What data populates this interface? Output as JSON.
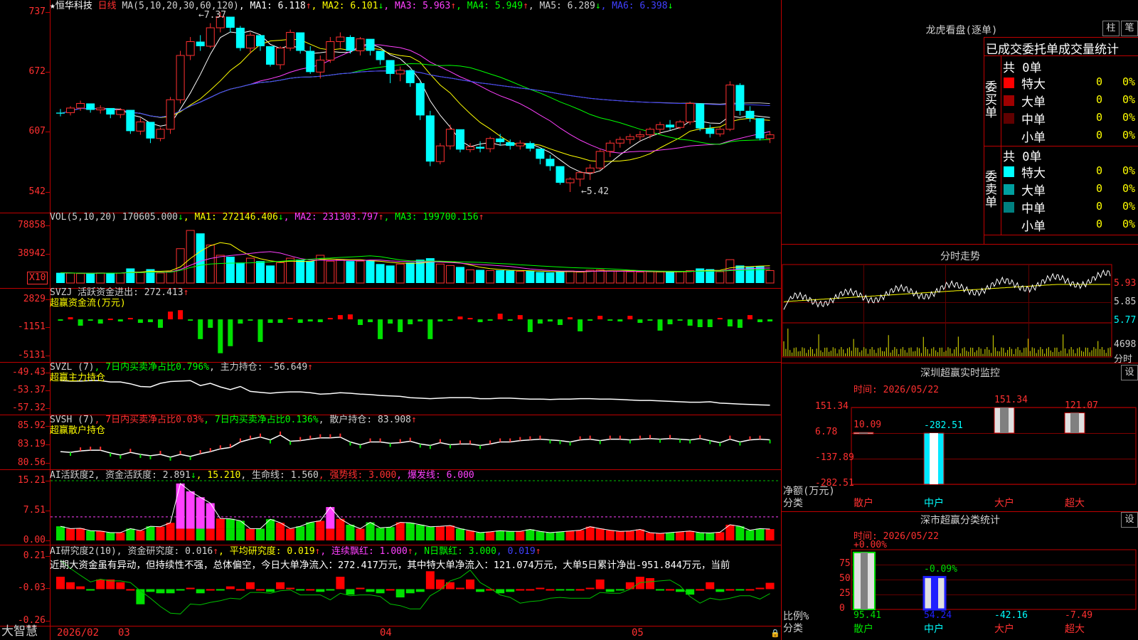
{
  "app": {
    "brand": "大智慧",
    "lock_icon": "lock-icon"
  },
  "main": {
    "title_star": "★",
    "stock_name": "恒华科技",
    "period": "日线",
    "ma_header": [
      {
        "text": "MA(5,10,20,30,60,120)",
        "color": "#d0d0d0"
      },
      {
        "text": "MA1: 6.118",
        "color": "#ffffff",
        "arrow": "↑"
      },
      {
        "text": "MA2: 6.101",
        "color": "#ffff00",
        "arrow": "↓"
      },
      {
        "text": "MA3: 5.963",
        "color": "#ff40ff",
        "arrow": "↑"
      },
      {
        "text": "MA4: 5.949",
        "color": "#00ff00",
        "arrow": "↑"
      },
      {
        "text": "MA5: 6.289",
        "color": "#d0d0d0",
        "arrow": "↓"
      },
      {
        "text": "MA6: 6.398",
        "color": "#4040ff",
        "arrow": "↓"
      }
    ],
    "high_note": "←7.37",
    "low_note": "←5.42",
    "yticks": [
      "737",
      "672",
      "607",
      "542"
    ]
  },
  "vol": {
    "header": [
      {
        "text": "VOL(5,10,20)  170605.000",
        "color": "#d0d0d0",
        "arrow": "↓"
      },
      {
        "text": "MA1: 272146.406",
        "color": "#ffff00",
        "arrow": "↓"
      },
      {
        "text": "MA2: 231303.797",
        "color": "#ff40ff",
        "arrow": "↑"
      },
      {
        "text": "MA3: 199700.156",
        "color": "#00ff00",
        "arrow": "↑"
      }
    ],
    "yticks": [
      "78858",
      "38942"
    ],
    "unit": "X10"
  },
  "svzj": {
    "header": [
      {
        "text": "SVZJ  活跃资金进出: 272.413",
        "color": "#d0d0d0",
        "arrow": "↑"
      }
    ],
    "subtitle": "超赢资金流(万元)",
    "yticks": [
      "2829",
      "-1151",
      "-5131"
    ]
  },
  "svzl": {
    "header": [
      {
        "text": "SVZL (7)",
        "color": "#d0d0d0"
      },
      {
        "text": "7日内买卖净占比0.796%",
        "color": "#00ff00"
      },
      {
        "text": "主力持仓: -56.649",
        "color": "#d0d0d0",
        "arrow": "↑"
      }
    ],
    "subtitle": "超赢主力持仓",
    "yticks": [
      "-49.43",
      "-53.37",
      "-57.32"
    ]
  },
  "svsh": {
    "header": [
      {
        "text": "SVSH (7)",
        "color": "#d0d0d0"
      },
      {
        "text": "7日内买卖净占比0.03%",
        "color": "#ff3030"
      },
      {
        "text": "7日内买卖净占比0.136%",
        "color": "#00ff00"
      },
      {
        "text": "散户持仓: 83.908",
        "color": "#d0d0d0",
        "arrow": "↑"
      }
    ],
    "subtitle": "超赢散户持仓",
    "yticks": [
      "85.92",
      "83.19",
      "80.56"
    ]
  },
  "ai1": {
    "header": [
      {
        "text": "AI活跃度2",
        "color": "#d0d0d0"
      },
      {
        "text": "资金活跃度: 2.891",
        "color": "#d0d0d0",
        "arrow": "↓"
      },
      {
        "text": "15.210",
        "color": "#ffff00"
      },
      {
        "text": "生命线: 1.560",
        "color": "#d0d0d0"
      },
      {
        "text": "强势线: 3.000",
        "color": "#ff3030"
      },
      {
        "text": "爆发线: 6.000",
        "color": "#ff40ff"
      }
    ],
    "yticks": [
      "15.21",
      "7.51",
      "0.00"
    ]
  },
  "ai2": {
    "header": [
      {
        "text": "AI研究度2(10)",
        "color": "#d0d0d0"
      },
      {
        "text": "资金研究度: 0.016",
        "color": "#d0d0d0",
        "arrow": "↑"
      },
      {
        "text": "平均研究度: 0.019",
        "color": "#ffff00",
        "arrow": "↑"
      },
      {
        "text": "连续飘红: 1.000",
        "color": "#ff40ff",
        "arrow": "↑"
      },
      {
        "text": "N日飘红: 3.000",
        "color": "#00ff00"
      },
      {
        "text": "0.019",
        "color": "#4040ff",
        "arrow": "↑"
      }
    ],
    "comment": "近期大资金虽有异动，但持续性不强，总体偏空，今日大单净流入：272.417万元，其中特大单净流入：121.074万元，大单5日累计净出-951.844万元，当前",
    "yticks": [
      "0.21",
      "-0.03",
      "-0.26"
    ]
  },
  "xaxis": {
    "labels": [
      "2026/02",
      "03",
      "04",
      "05"
    ]
  },
  "dragon": {
    "title": "龙虎看盘(逐单)",
    "btn1": "柱",
    "btn2": "笔",
    "subtitle": "已成交委托单成交量统计",
    "buy_side": "委买单",
    "sell_side": "委卖单",
    "buy_total": "共 0单",
    "sell_total": "共 0单",
    "buy_rows": [
      {
        "label": "特大",
        "count": "0",
        "pct": "0%",
        "color": "#ff0000"
      },
      {
        "label": "大单",
        "count": "0",
        "pct": "0%",
        "color": "#a00000"
      },
      {
        "label": "中单",
        "count": "0",
        "pct": "0%",
        "color": "#600000"
      },
      {
        "label": "小单",
        "count": "0",
        "pct": "0%",
        "color": ""
      }
    ],
    "sell_rows": [
      {
        "label": "特大",
        "count": "0",
        "pct": "0%",
        "color": "#00ffff"
      },
      {
        "label": "大单",
        "count": "0",
        "pct": "0%",
        "color": "#00a0a0"
      },
      {
        "label": "中单",
        "count": "0",
        "pct": "0%",
        "color": "#008080"
      },
      {
        "label": "小单",
        "count": "0",
        "pct": "0%",
        "color": ""
      }
    ]
  },
  "intraday": {
    "title": "分时走势",
    "yticks": [
      "5.93",
      "5.85",
      "5.77"
    ],
    "vol_tick": "4698",
    "vol_label": "分时"
  },
  "monitor": {
    "title": "深圳超赢实时监控",
    "setting": "设",
    "time": "时间: 2026/05/22",
    "yticks": [
      "151.34",
      "6.78",
      "-137.89",
      "-282.51"
    ],
    "ylabel": "净额(万元)",
    "xlabel": "分类",
    "categories": [
      "散户",
      "中户",
      "大户",
      "超大"
    ],
    "values": [
      10.09,
      -282.51,
      151.34,
      121.07
    ],
    "value_labels": [
      "10.09",
      "-282.51",
      "151.34",
      "121.07"
    ]
  },
  "classify": {
    "title": "深市超赢分类统计",
    "setting": "设",
    "time": "时间: 2026/05/22",
    "yticks": [
      "75",
      "50",
      "25",
      "0"
    ],
    "ylabel": "比例%",
    "xlabel": "分类",
    "categories": [
      "散户",
      "中户",
      "大户",
      "超大"
    ],
    "top_labels": [
      "+0.00%",
      "-0.09%"
    ],
    "values": [
      "95.41",
      "54.24",
      "-42.16",
      "-7.49"
    ]
  },
  "chart_data": [
    {
      "type": "candlestick",
      "title": "恒华科技 日线",
      "ylim": [
        5.42,
        7.37
      ],
      "yticks": [
        7.37,
        6.72,
        6.07,
        5.42
      ],
      "annotations": [
        "7.37 high",
        "5.42 low"
      ],
      "candles": [
        [
          6.28,
          6.32,
          6.24,
          6.27
        ],
        [
          6.28,
          6.35,
          6.25,
          6.33
        ],
        [
          6.33,
          6.41,
          6.3,
          6.38
        ],
        [
          6.38,
          6.35,
          6.28,
          6.31
        ],
        [
          6.31,
          6.36,
          6.27,
          6.33
        ],
        [
          6.33,
          6.3,
          6.22,
          6.26
        ],
        [
          6.26,
          6.33,
          6.22,
          6.31
        ],
        [
          6.31,
          6.25,
          6.05,
          6.08
        ],
        [
          6.08,
          6.22,
          6.04,
          6.18
        ],
        [
          6.18,
          6.05,
          5.95,
          6.0
        ],
        [
          6.0,
          6.12,
          5.97,
          6.1
        ],
        [
          6.1,
          6.45,
          6.05,
          6.42
        ],
        [
          6.42,
          6.95,
          6.38,
          6.9
        ],
        [
          6.9,
          7.1,
          6.85,
          7.05
        ],
        [
          7.05,
          7.12,
          6.95,
          7.0
        ],
        [
          7.0,
          7.25,
          6.98,
          7.2
        ],
        [
          7.2,
          7.37,
          7.15,
          7.32
        ],
        [
          7.32,
          7.3,
          7.15,
          7.2
        ],
        [
          7.2,
          7.22,
          6.95,
          6.98
        ],
        [
          6.98,
          7.15,
          6.92,
          7.12
        ],
        [
          7.12,
          7.1,
          6.95,
          7.0
        ],
        [
          7.0,
          6.95,
          6.78,
          6.8
        ],
        [
          6.8,
          7.0,
          6.75,
          6.98
        ],
        [
          6.98,
          7.18,
          6.95,
          7.15
        ],
        [
          7.15,
          7.08,
          6.92,
          6.95
        ],
        [
          6.95,
          7.0,
          6.7,
          6.72
        ],
        [
          6.72,
          6.9,
          6.65,
          6.85
        ],
        [
          6.85,
          7.1,
          6.82,
          7.05
        ],
        [
          7.05,
          7.15,
          6.98,
          7.1
        ],
        [
          7.1,
          7.12,
          6.92,
          6.95
        ],
        [
          6.95,
          7.1,
          6.9,
          7.08
        ],
        [
          7.08,
          7.02,
          6.9,
          6.95
        ],
        [
          6.95,
          6.92,
          6.8,
          6.85
        ],
        [
          6.85,
          6.8,
          6.6,
          6.7
        ],
        [
          6.7,
          6.78,
          6.62,
          6.74
        ],
        [
          6.74,
          6.75,
          6.56,
          6.6
        ],
        [
          6.6,
          6.62,
          6.2,
          6.25
        ],
        [
          6.25,
          6.3,
          5.7,
          5.75
        ],
        [
          5.75,
          5.95,
          5.72,
          5.92
        ],
        [
          5.92,
          6.15,
          5.88,
          6.1
        ],
        [
          6.1,
          6.05,
          5.85,
          5.88
        ],
        [
          5.88,
          5.95,
          5.85,
          5.91
        ],
        [
          5.91,
          5.97,
          5.85,
          5.89
        ],
        [
          5.89,
          6.02,
          5.85,
          6.0
        ],
        [
          6.0,
          6.05,
          5.92,
          5.96
        ],
        [
          5.96,
          5.99,
          5.88,
          5.92
        ],
        [
          5.92,
          5.98,
          5.88,
          5.95
        ],
        [
          5.95,
          5.97,
          5.86,
          5.89
        ],
        [
          5.89,
          5.86,
          5.72,
          5.78
        ],
        [
          5.78,
          5.82,
          5.65,
          5.7
        ],
        [
          5.7,
          5.66,
          5.5,
          5.52
        ],
        [
          5.52,
          5.58,
          5.42,
          5.56
        ],
        [
          5.56,
          5.65,
          5.48,
          5.63
        ],
        [
          5.63,
          5.72,
          5.55,
          5.68
        ],
        [
          5.68,
          5.88,
          5.66,
          5.86
        ],
        [
          5.86,
          5.98,
          5.8,
          5.95
        ],
        [
          5.95,
          6.02,
          5.9,
          5.99
        ],
        [
          5.99,
          6.05,
          5.94,
          6.02
        ],
        [
          6.02,
          6.08,
          5.98,
          6.04
        ],
        [
          6.04,
          6.12,
          6.0,
          6.1
        ],
        [
          6.1,
          6.18,
          6.05,
          6.15
        ],
        [
          6.15,
          6.2,
          6.09,
          6.12
        ],
        [
          6.12,
          6.2,
          6.1,
          6.18
        ],
        [
          6.18,
          6.4,
          6.15,
          6.38
        ],
        [
          6.38,
          6.3,
          6.08,
          6.11
        ],
        [
          6.11,
          6.15,
          6.01,
          6.05
        ],
        [
          6.05,
          6.12,
          6.02,
          6.1
        ],
        [
          6.1,
          6.62,
          6.08,
          6.58
        ],
        [
          6.58,
          6.6,
          6.25,
          6.3
        ],
        [
          6.3,
          6.35,
          6.18,
          6.22
        ],
        [
          6.22,
          6.2,
          5.98,
          6.0
        ],
        [
          6.0,
          6.08,
          5.95,
          6.04
        ]
      ]
    },
    {
      "type": "bar",
      "title": "VOL(5,10,20)",
      "ylim": [
        0,
        78858
      ],
      "yticks": [
        78858,
        38942
      ],
      "values": [
        14000,
        13500,
        13000,
        13200,
        13800,
        14100,
        13500,
        20000,
        14200,
        19000,
        13800,
        16000,
        47000,
        72000,
        68000,
        52000,
        38000,
        36000,
        28000,
        34000,
        30000,
        24000,
        28000,
        34000,
        32000,
        30000,
        38000,
        30000,
        32000,
        30000,
        30000,
        31000,
        26000,
        24000,
        26000,
        28000,
        32000,
        34000,
        26000,
        24000,
        22000,
        18000,
        18000,
        17000,
        17500,
        17000,
        16000,
        16500,
        15000,
        14500,
        16000,
        16500,
        15000,
        17500,
        18000,
        16500,
        16000,
        15500,
        15000,
        15500,
        15200,
        15000,
        15800,
        17000,
        20000,
        19000,
        15500,
        32000,
        24000,
        22000,
        23000,
        17060
      ]
    },
    {
      "type": "bar",
      "title": "超赢资金流(万元)",
      "ylim": [
        -5131,
        2829
      ],
      "yticks": [
        2829,
        -1151,
        -5131
      ],
      "values": [
        -200,
        300,
        -900,
        -200,
        -600,
        100,
        -300,
        200,
        -500,
        -400,
        -1200,
        1100,
        1300,
        -200,
        -2800,
        -1200,
        -4800,
        -3800,
        -600,
        -200,
        -3200,
        -500,
        -500,
        200,
        -500,
        -300,
        -400,
        200,
        600,
        700,
        -800,
        -400,
        -2800,
        -600,
        -1800,
        -700,
        -300,
        -2800,
        -300,
        -200,
        400,
        200,
        -400,
        -100,
        800,
        -200,
        600,
        -1800,
        -600,
        -300,
        -800,
        300,
        -1700,
        -200,
        500,
        -200,
        -300,
        500,
        -500,
        -100,
        -1600,
        -700,
        -200,
        -900,
        -1100,
        -1100,
        200,
        -1000,
        -1200,
        600,
        -400,
        -300,
        -600,
        -2000,
        272
      ]
    },
    {
      "type": "line",
      "title": "超赢主力持仓",
      "ylim": [
        -57.32,
        -49.43
      ],
      "yticks": [
        -49.43,
        -53.37,
        -57.32
      ],
      "values": [
        -51.2,
        -51.3,
        -51.3,
        -51.2,
        -51.2,
        -51.5,
        -51.5,
        -51.9,
        -52.5,
        -52.6,
        -51.8,
        -51.4,
        -51.3,
        -51.2,
        -52.3,
        -51.8,
        -52.6,
        -53.2,
        -52.5,
        -53.6,
        -53.8,
        -54.0,
        -53.8,
        -53.7,
        -53.7,
        -53.9,
        -54.2,
        -54.1,
        -53.9,
        -54.0,
        -54.2,
        -54.3,
        -54.5,
        -54.6,
        -54.7,
        -55.0,
        -55.1,
        -55.2,
        -55.1,
        -55.0,
        -55.0,
        -55.0,
        -55.2,
        -55.2,
        -55.1,
        -55.1,
        -55.2,
        -55.3,
        -55.3,
        -55.4,
        -55.3,
        -55.3,
        -55.2,
        -55.2,
        -55.3,
        -55.3,
        -55.4,
        -55.5,
        -55.6,
        -55.6,
        -55.7,
        -55.8,
        -55.9,
        -56.0,
        -56.0,
        -55.9,
        -56.2,
        -56.3,
        -56.4,
        -56.5,
        -56.6,
        -56.649
      ]
    },
    {
      "type": "line",
      "title": "超赢散户持仓",
      "ylim": [
        80.56,
        85.92
      ],
      "yticks": [
        85.92,
        83.19,
        80.56
      ],
      "values": [
        82.2,
        82.1,
        82.3,
        82.4,
        82.4,
        82.0,
        81.7,
        82.1,
        81.8,
        81.6,
        81.8,
        81.4,
        81.8,
        81.5,
        81.9,
        82.2,
        82.6,
        82.8,
        83.6,
        84.0,
        84.3,
        83.9,
        84.6,
        83.7,
        83.8,
        84.0,
        84.2,
        84.2,
        84.3,
        83.6,
        83.2,
        83.6,
        83.6,
        83.4,
        83.5,
        83.7,
        83.3,
        83.1,
        83.5,
        83.2,
        83.3,
        83.3,
        83.1,
        83.3,
        83.6,
        83.6,
        83.8,
        83.9,
        84.0,
        83.9,
        83.8,
        83.6,
        83.9,
        84.0,
        83.8,
        84.0,
        84.0,
        83.9,
        84.0,
        84.1,
        84.0,
        84.1,
        84.0,
        83.9,
        84.1,
        83.8,
        83.5,
        84.0,
        83.6,
        83.9,
        84.0,
        83.908
      ]
    },
    {
      "type": "bar",
      "title": "AI活跃度2",
      "ylim": [
        0,
        15.21
      ],
      "yticks": [
        15.21,
        7.51,
        0.0
      ],
      "values": [
        3.6,
        3.0,
        3.1,
        2.5,
        2.4,
        2.0,
        2.0,
        3.0,
        2.5,
        3.6,
        3.5,
        4.5,
        14.5,
        12.5,
        11.0,
        9.5,
        5.6,
        5.5,
        5.0,
        3.0,
        3.0,
        5.4,
        4.5,
        3.0,
        3.6,
        4.6,
        5.0,
        8.5,
        5.5,
        4.0,
        3.0,
        4.6,
        3.2,
        3.4,
        4.6,
        4.5,
        4.0,
        3.5,
        3.6,
        3.8,
        3.0,
        2.5,
        2.0,
        2.2,
        2.5,
        2.3,
        2.3,
        2.8,
        2.3,
        2.0,
        2.2,
        2.4,
        2.6,
        3.5,
        3.0,
        2.6,
        2.3,
        2.4,
        2.8,
        2.0,
        1.8,
        2.0,
        2.2,
        2.4,
        2.0,
        1.9,
        2.1,
        4.0,
        3.6,
        2.6,
        3.0,
        2.891
      ],
      "lines": {
        "strong": 3.0,
        "burst": 6.0,
        "top": 15.21
      }
    },
    {
      "type": "bar",
      "title": "AI研究度2(10)",
      "ylim": [
        -0.26,
        0.21
      ],
      "yticks": [
        0.21,
        -0.03,
        -0.26
      ],
      "values": [
        0.06,
        0.02,
        -0.01,
        -0.04,
        0.04,
        0.04,
        0.02,
        -0.03,
        -0.14,
        -0.05,
        -0.06,
        -0.06,
        -0.04,
        -0.02,
        -0.06,
        -0.03,
        -0.04,
        -0.01,
        -0.03,
        0.02,
        -0.03,
        -0.05,
        0.02,
        -0.02,
        -0.04,
        -0.03,
        -0.05,
        -0.04,
        0.06,
        -0.07,
        -0.02,
        -0.05,
        -0.06,
        -0.03,
        -0.09,
        -0.06,
        -0.05,
        0.1,
        0.04,
        0.02,
        -0.02,
        0.04,
        -0.05,
        -0.03,
        -0.06,
        -0.05,
        -0.03,
        -0.03,
        -0.02,
        -0.03,
        -0.04,
        -0.04,
        -0.03,
        -0.02,
        0.04,
        -0.05,
        -0.04,
        0.02,
        0.06,
        0.05,
        -0.04,
        -0.03,
        -0.05,
        -0.07,
        -0.03,
        0.02,
        -0.05,
        -0.03,
        -0.04,
        -0.03,
        -0.02,
        0.016
      ]
    }
  ]
}
